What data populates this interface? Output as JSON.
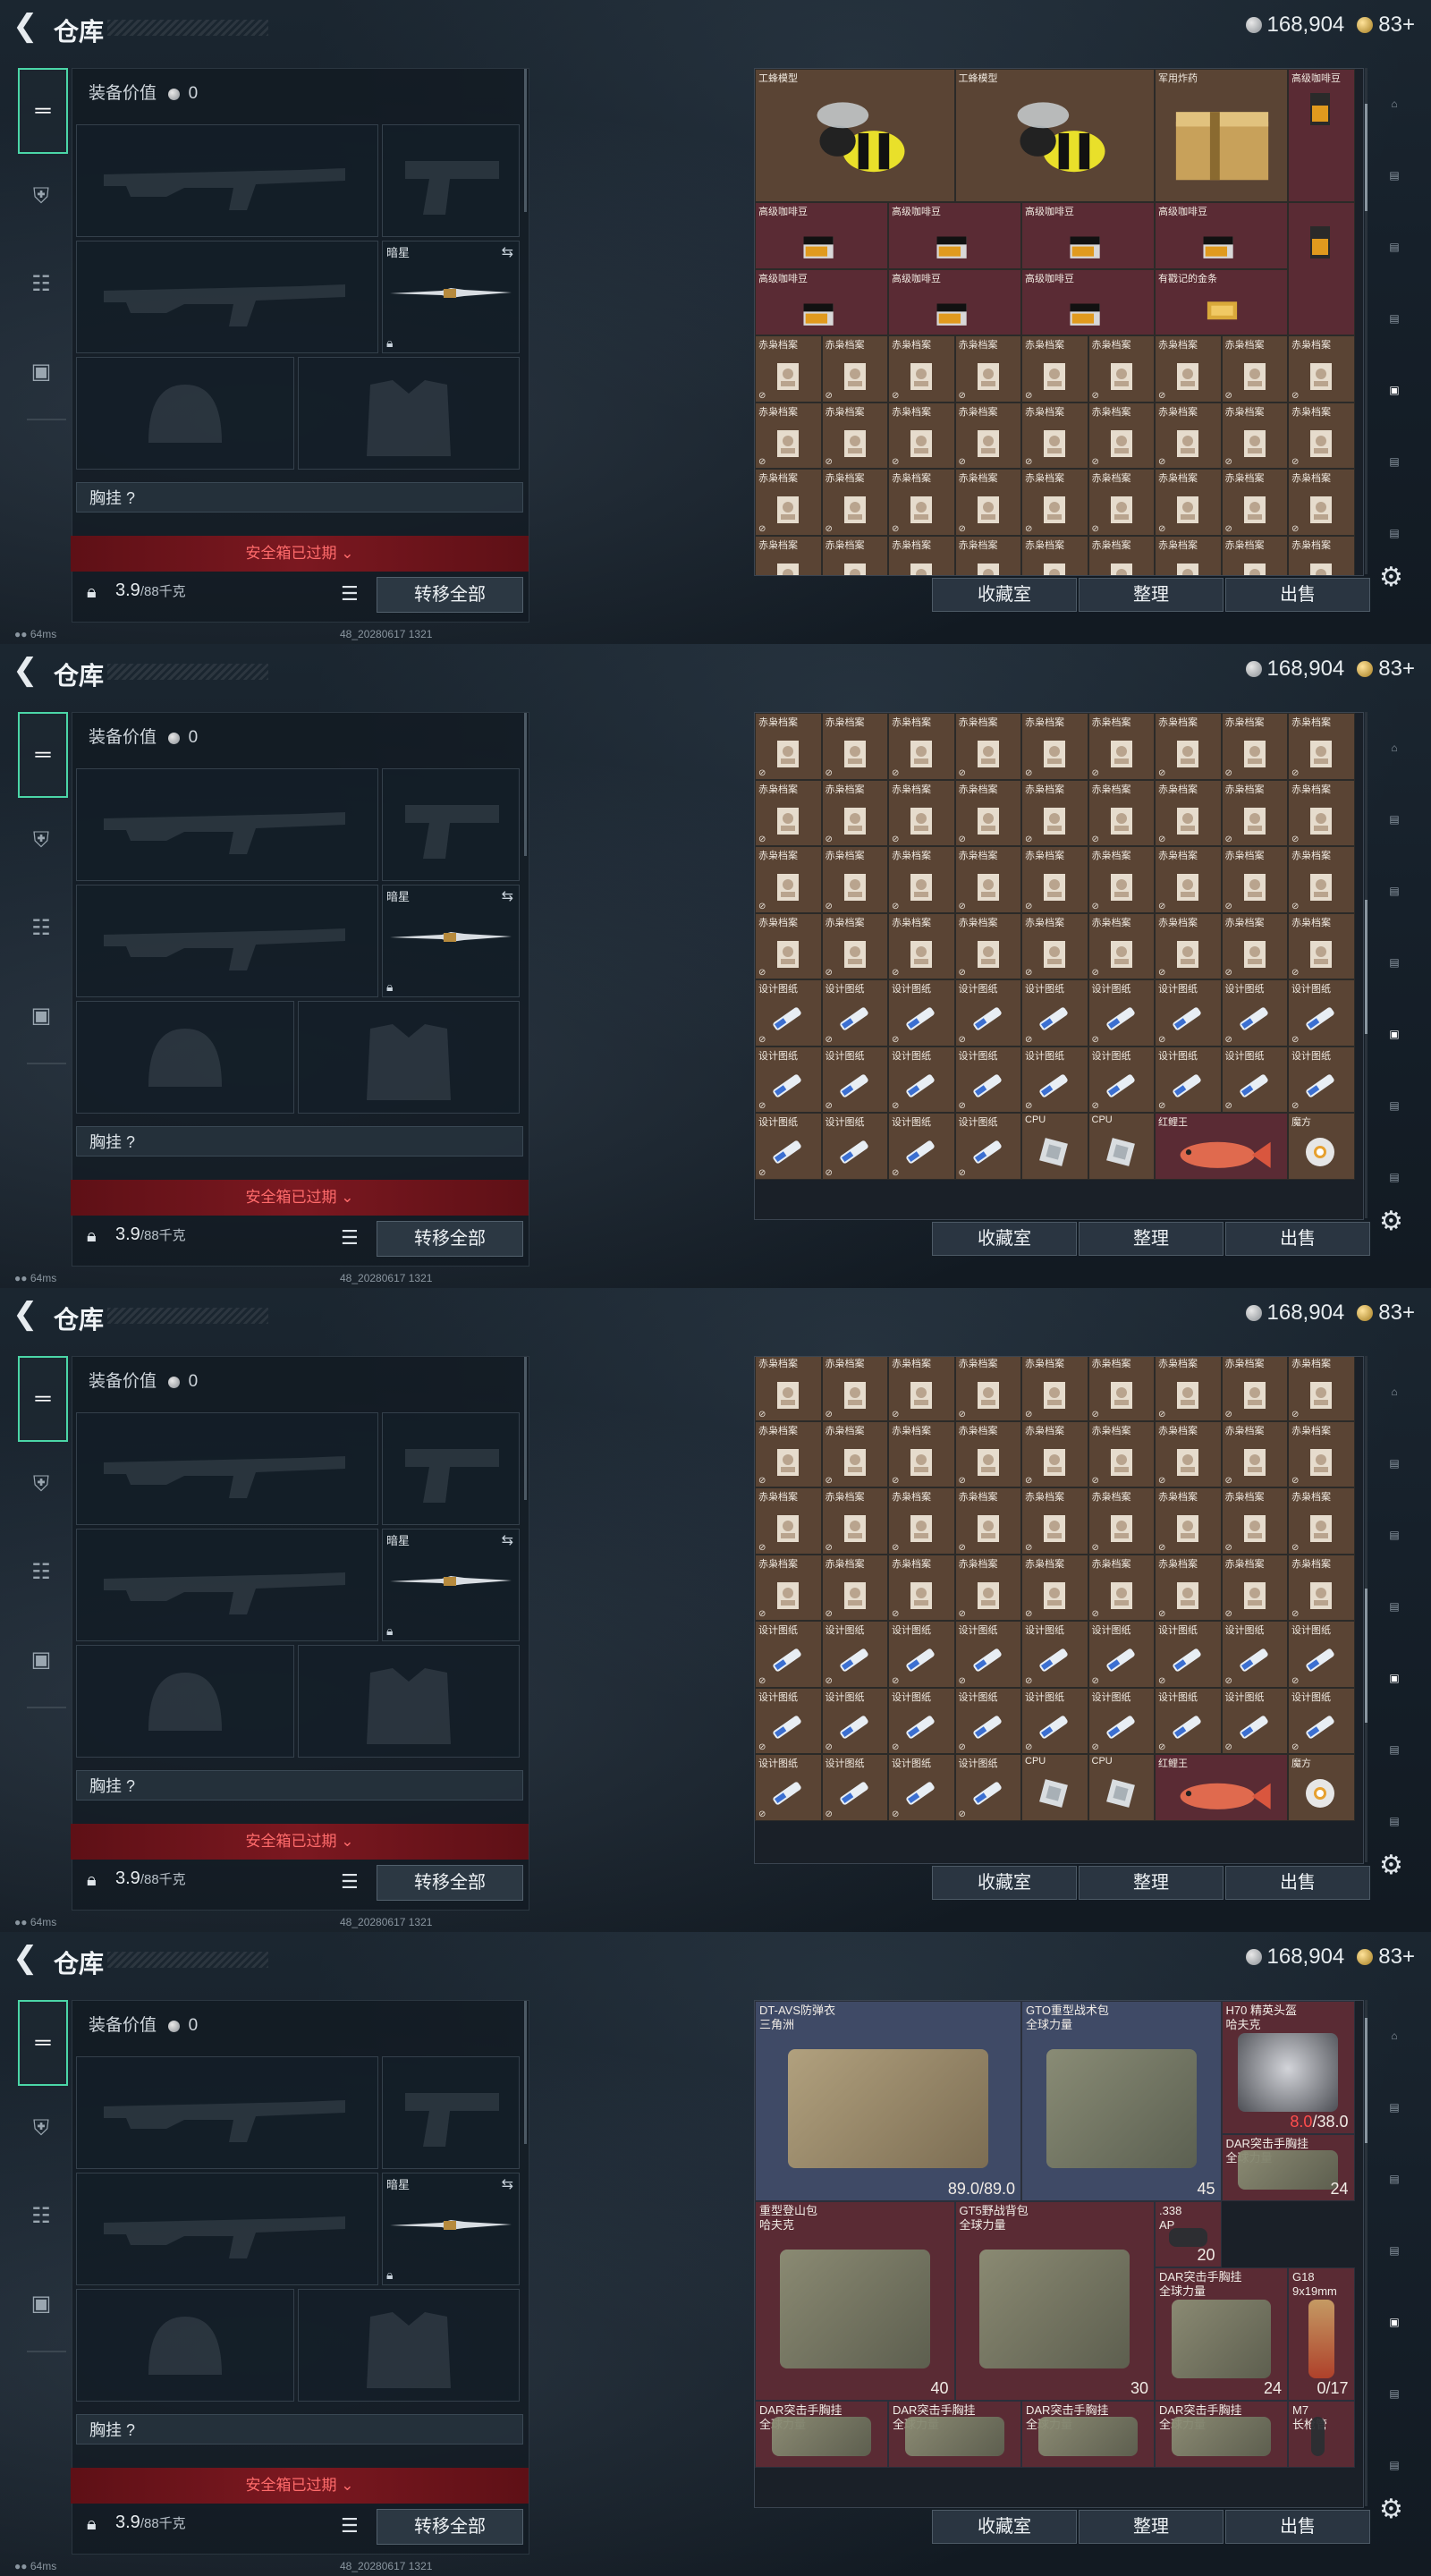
{
  "header": {
    "title": "仓库",
    "silver": "168,904",
    "gold": "83+"
  },
  "equipment": {
    "value_label": "装备价值",
    "value": "0",
    "melee_name": "暗星",
    "chest_rig_label": "胸挂 ?",
    "safe_box_status": "安全箱已过期",
    "weight": "3.9",
    "weight_max": "/88千克",
    "transfer_all": "转移全部"
  },
  "warehouse_buttons": {
    "collection": "收藏室",
    "organize": "整理",
    "sell": "出售"
  },
  "footer": {
    "ping": "64ms",
    "build": "48_20280617 1321"
  },
  "item_names": {
    "bee": "工蜂模型",
    "explosive": "军用炸药",
    "coffee": "高级咖啡豆",
    "gold": "有戳记的金条",
    "file": "赤枭档案",
    "blueprint": "设计图纸",
    "cpu": "CPU",
    "fish": "红鲤王",
    "cube": "魔方"
  },
  "panel4": {
    "armor": {
      "name": "DT-AVS防弹衣",
      "sub": "三角洲",
      "dur": "89.0/89.0"
    },
    "bag1": {
      "name": "GTO重型战术包",
      "sub": "全球力量",
      "count": "45"
    },
    "helmet": {
      "name": "H70 精英头盔",
      "sub": "哈夫克",
      "dur_now": "8.0",
      "dur_max": "/38.0"
    },
    "rig1": {
      "name": "DAR突击手胸挂",
      "sub": "全球力量",
      "count": "24"
    },
    "bag2": {
      "name": "重型登山包",
      "sub": "哈夫克",
      "count": "40"
    },
    "bag3": {
      "name": "GT5野战背包",
      "sub": "全球力量",
      "count": "30"
    },
    "ammo": {
      "name": ".338",
      "sub": "AP",
      "count": "20"
    },
    "rig2": {
      "name": "DAR突击手胸挂",
      "sub": "全球力量",
      "count": "24"
    },
    "pistol": {
      "name": "G18",
      "sub": "9x19mm",
      "count": "0/17"
    },
    "rig3": {
      "name": "DAR突击手胸挂",
      "sub": "全球力量"
    },
    "rig4": {
      "name": "DAR突击手胸挂",
      "sub": "全球力量"
    },
    "rig5": {
      "name": "DAR突击手胸挂",
      "sub": "全球力量"
    },
    "rig6": {
      "name": "DAR突击手胸挂",
      "sub": "全球力量"
    },
    "m7": {
      "name": "M7",
      "sub": "长枪管"
    }
  },
  "colors": {
    "accent": "#4bd6a7",
    "expired": "#7b1820",
    "cell_brown": "#5a4434",
    "cell_red": "#5a2b34",
    "cell_blue": "#3f4a66"
  }
}
